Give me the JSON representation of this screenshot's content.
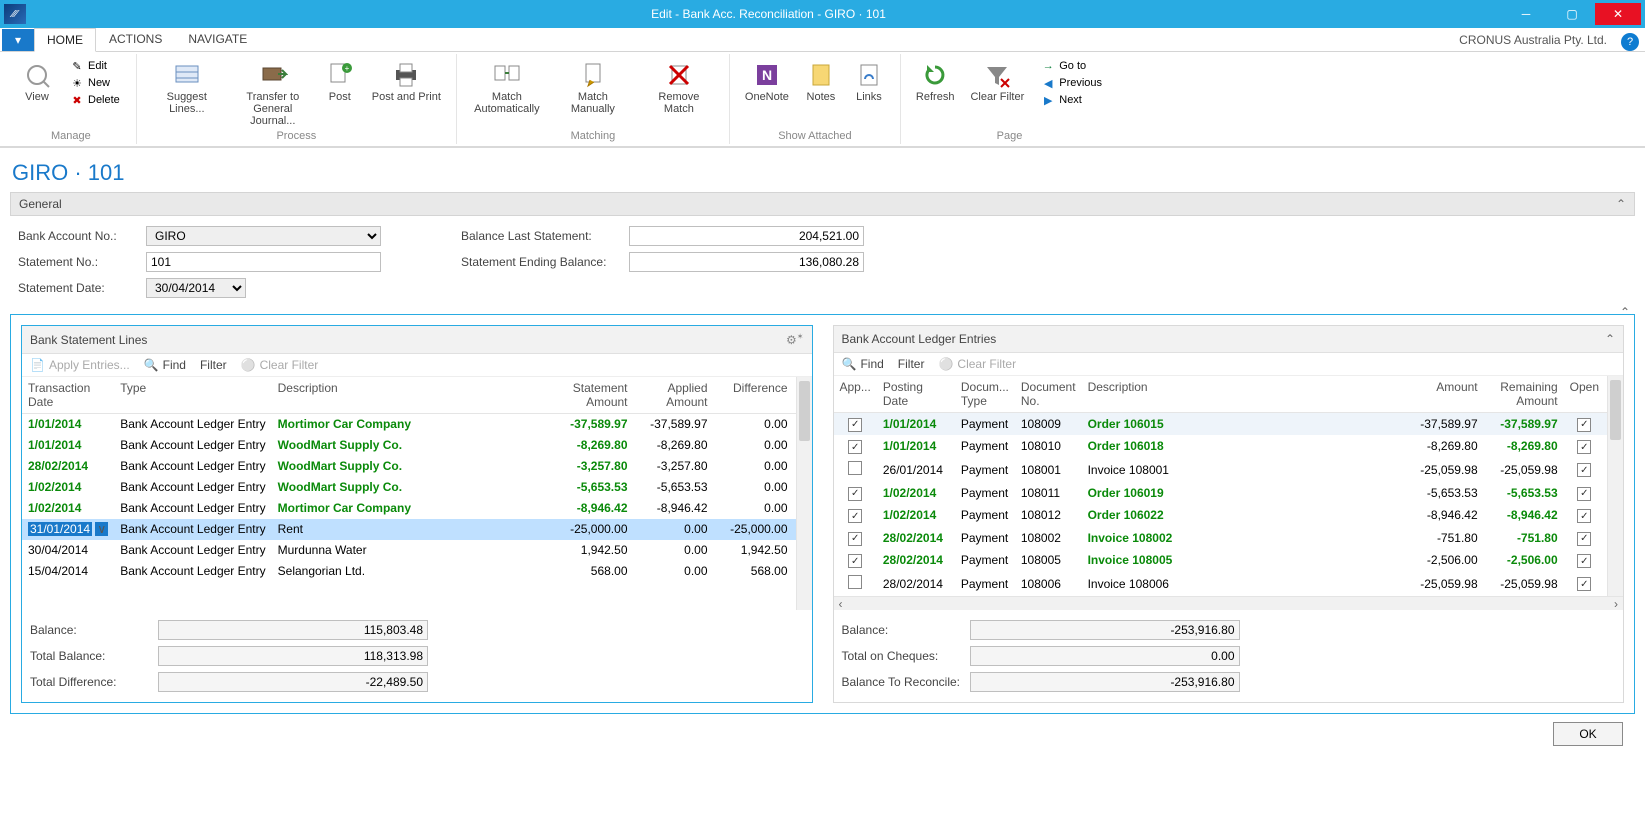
{
  "window": {
    "title": "Edit - Bank Acc. Reconciliation - GIRO · 101"
  },
  "tabs": {
    "home": "HOME",
    "actions": "ACTIONS",
    "navigate": "NAVIGATE",
    "company": "CRONUS Australia Pty. Ltd."
  },
  "ribbon": {
    "manage": {
      "group": "Manage",
      "view": "View",
      "edit": "Edit",
      "new": "New",
      "delete": "Delete"
    },
    "process": {
      "group": "Process",
      "suggest": "Suggest Lines...",
      "transfer": "Transfer to General Journal...",
      "post": "Post",
      "postprint": "Post and Print"
    },
    "matching": {
      "group": "Matching",
      "auto": "Match Automatically",
      "manual": "Match Manually",
      "remove": "Remove Match"
    },
    "showattached": {
      "group": "Show Attached",
      "onenote": "OneNote",
      "notes": "Notes",
      "links": "Links"
    },
    "page": {
      "group": "Page",
      "refresh": "Refresh",
      "clearfilter": "Clear Filter",
      "goto": "Go to",
      "previous": "Previous",
      "next": "Next"
    }
  },
  "page_title": "GIRO · 101",
  "general": {
    "header": "General",
    "bank_account_no_label": "Bank Account No.:",
    "bank_account_no": "GIRO",
    "statement_no_label": "Statement No.:",
    "statement_no": "101",
    "statement_date_label": "Statement Date:",
    "statement_date": "30/04/2014",
    "balance_last_label": "Balance Last Statement:",
    "balance_last": "204,521.00",
    "ending_balance_label": "Statement Ending Balance:",
    "ending_balance": "136,080.28"
  },
  "left_pane": {
    "title": "Bank Statement Lines",
    "toolbar": {
      "apply": "Apply Entries...",
      "find": "Find",
      "filter": "Filter",
      "clear": "Clear Filter"
    },
    "cols": {
      "date": "Transaction Date",
      "type": "Type",
      "desc": "Description",
      "stmt": "Statement Amount",
      "applied": "Applied Amount",
      "diff": "Difference"
    },
    "rows": [
      {
        "date": "1/01/2014",
        "type": "Bank Account Ledger Entry",
        "desc": "Mortimor Car Company",
        "stmt": "-37,589.97",
        "applied": "-37,589.97",
        "diff": "0.00",
        "matched": true
      },
      {
        "date": "1/01/2014",
        "type": "Bank Account Ledger Entry",
        "desc": "WoodMart Supply Co.",
        "stmt": "-8,269.80",
        "applied": "-8,269.80",
        "diff": "0.00",
        "matched": true
      },
      {
        "date": "28/02/2014",
        "type": "Bank Account Ledger Entry",
        "desc": "WoodMart Supply Co.",
        "stmt": "-3,257.80",
        "applied": "-3,257.80",
        "diff": "0.00",
        "matched": true
      },
      {
        "date": "1/02/2014",
        "type": "Bank Account Ledger Entry",
        "desc": "WoodMart Supply Co.",
        "stmt": "-5,653.53",
        "applied": "-5,653.53",
        "diff": "0.00",
        "matched": true
      },
      {
        "date": "1/02/2014",
        "type": "Bank Account Ledger Entry",
        "desc": "Mortimor Car Company",
        "stmt": "-8,946.42",
        "applied": "-8,946.42",
        "diff": "0.00",
        "matched": true
      },
      {
        "date": "31/01/2014",
        "type": "Bank Account Ledger Entry",
        "desc": "Rent",
        "stmt": "-25,000.00",
        "applied": "0.00",
        "diff": "-25,000.00",
        "matched": false,
        "selected": true
      },
      {
        "date": "30/04/2014",
        "type": "Bank Account Ledger Entry",
        "desc": "Murdunna Water",
        "stmt": "1,942.50",
        "applied": "0.00",
        "diff": "1,942.50",
        "matched": false
      },
      {
        "date": "15/04/2014",
        "type": "Bank Account Ledger Entry",
        "desc": "Selangorian Ltd.",
        "stmt": "568.00",
        "applied": "0.00",
        "diff": "568.00",
        "matched": false
      }
    ],
    "footer": {
      "balance_label": "Balance:",
      "balance": "115,803.48",
      "total_balance_label": "Total Balance:",
      "total_balance": "118,313.98",
      "total_diff_label": "Total Difference:",
      "total_diff": "-22,489.50"
    }
  },
  "right_pane": {
    "title": "Bank Account Ledger Entries",
    "toolbar": {
      "find": "Find",
      "filter": "Filter",
      "clear": "Clear Filter"
    },
    "cols": {
      "app": "App...",
      "posting": "Posting Date",
      "doctype": "Docum... Type",
      "docno": "Document No.",
      "desc": "Description",
      "amount": "Amount",
      "remaining": "Remaining Amount",
      "open": "Open"
    },
    "rows": [
      {
        "app": true,
        "posting": "1/01/2014",
        "doctype": "Payment",
        "docno": "108009",
        "desc": "Order 106015",
        "amount": "-37,589.97",
        "remaining": "-37,589.97",
        "open": true,
        "matched": true,
        "selected": true
      },
      {
        "app": true,
        "posting": "1/01/2014",
        "doctype": "Payment",
        "docno": "108010",
        "desc": "Order 106018",
        "amount": "-8,269.80",
        "remaining": "-8,269.80",
        "open": true,
        "matched": true
      },
      {
        "app": false,
        "posting": "26/01/2014",
        "doctype": "Payment",
        "docno": "108001",
        "desc": "Invoice 108001",
        "amount": "-25,059.98",
        "remaining": "-25,059.98",
        "open": true,
        "matched": false
      },
      {
        "app": true,
        "posting": "1/02/2014",
        "doctype": "Payment",
        "docno": "108011",
        "desc": "Order 106019",
        "amount": "-5,653.53",
        "remaining": "-5,653.53",
        "open": true,
        "matched": true
      },
      {
        "app": true,
        "posting": "1/02/2014",
        "doctype": "Payment",
        "docno": "108012",
        "desc": "Order 106022",
        "amount": "-8,946.42",
        "remaining": "-8,946.42",
        "open": true,
        "matched": true
      },
      {
        "app": true,
        "posting": "28/02/2014",
        "doctype": "Payment",
        "docno": "108002",
        "desc": "Invoice 108002",
        "amount": "-751.80",
        "remaining": "-751.80",
        "open": true,
        "matched": true
      },
      {
        "app": true,
        "posting": "28/02/2014",
        "doctype": "Payment",
        "docno": "108005",
        "desc": "Invoice 108005",
        "amount": "-2,506.00",
        "remaining": "-2,506.00",
        "open": true,
        "matched": true
      },
      {
        "app": false,
        "posting": "28/02/2014",
        "doctype": "Payment",
        "docno": "108006",
        "desc": "Invoice 108006",
        "amount": "-25,059.98",
        "remaining": "-25,059.98",
        "open": true,
        "matched": false
      }
    ],
    "footer": {
      "balance_label": "Balance:",
      "balance": "-253,916.80",
      "cheques_label": "Total on Cheques:",
      "cheques": "0.00",
      "reconcile_label": "Balance To Reconcile:",
      "reconcile": "-253,916.80"
    }
  },
  "ok_button": "OK"
}
